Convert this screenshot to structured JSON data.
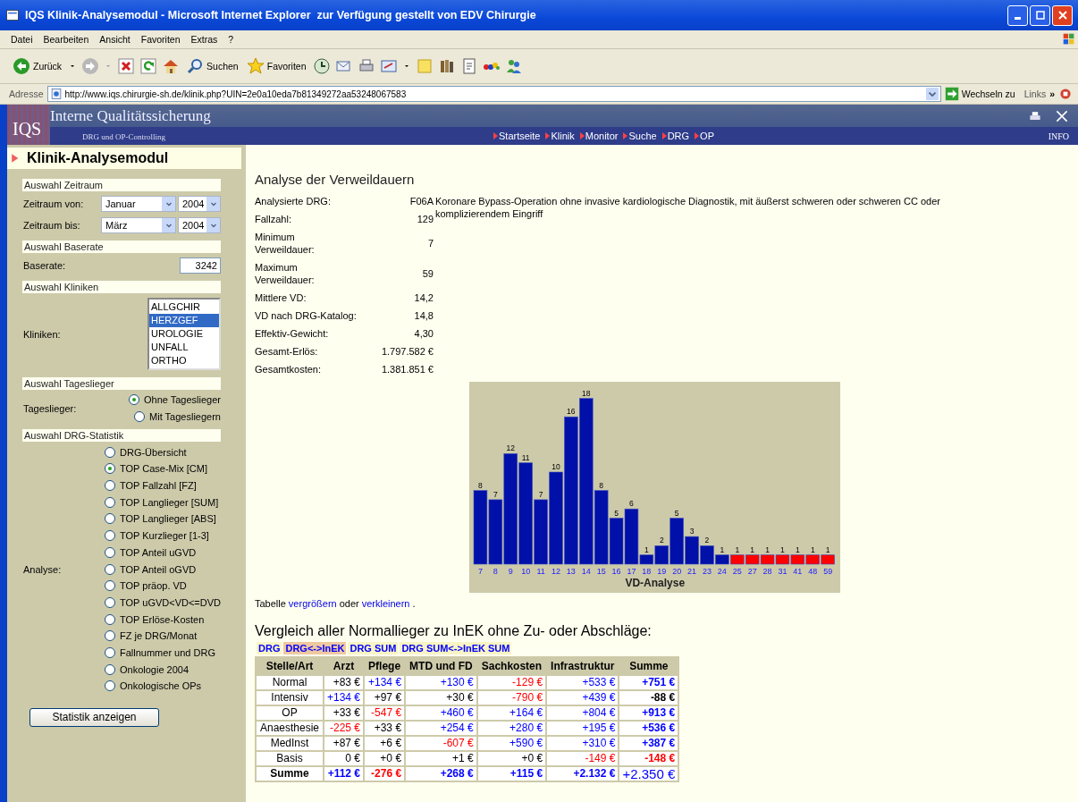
{
  "window": {
    "title": "IQS Klinik-Analysemodul - Microsoft Internet Explorer  zur Verfügung gestellt von EDV Chirurgie"
  },
  "menu": [
    "Datei",
    "Bearbeiten",
    "Ansicht",
    "Favoriten",
    "Extras",
    "?"
  ],
  "toolbar": {
    "back": "Zurück",
    "search": "Suchen",
    "favorites": "Favoriten"
  },
  "address_bar": {
    "label": "Adresse",
    "url": "http://www.iqs.chirurgie-sh.de/klinik.php?UIN=2e0a10eda7b81349272aa53248067583",
    "go": "Wechseln zu",
    "links": "Links",
    "more": "»"
  },
  "site_header": {
    "logo": "IQS",
    "title": "Interne Qualitätssicherung",
    "subtitle": "DRG und OP-Controlling",
    "nav": [
      "Startseite",
      "Klinik",
      "Monitor",
      "Suche",
      "DRG",
      "OP"
    ],
    "info": "INFO"
  },
  "sidebar": {
    "title": "Klinik-Analysemodul",
    "zeitraum": {
      "heading": "Auswahl Zeitraum",
      "rows": [
        {
          "label": "Zeitraum von:",
          "month": "Januar",
          "year": "2004"
        },
        {
          "label": "Zeitraum bis:",
          "month": "März",
          "year": "2004"
        }
      ]
    },
    "baserate": {
      "heading": "Auswahl Baserate",
      "label": "Baserate:",
      "value": "3242"
    },
    "kliniken": {
      "heading": "Auswahl Kliniken",
      "label": "Kliniken:",
      "options": [
        {
          "text": "ALLGCHIR",
          "selected": false
        },
        {
          "text": "HERZGEF",
          "selected": true
        },
        {
          "text": "UROLOGIE",
          "selected": false
        },
        {
          "text": "UNFALL",
          "selected": false
        },
        {
          "text": "ORTHO",
          "selected": false
        }
      ]
    },
    "tageslieger": {
      "heading": "Auswahl Tageslieger",
      "label": "Tageslieger:",
      "options": [
        {
          "text": "Ohne Tageslieger",
          "selected": true
        },
        {
          "text": "Mit Tagesliegern",
          "selected": false
        }
      ]
    },
    "statistik": {
      "heading": "Auswahl DRG-Statistik",
      "label": "Analyse:",
      "options": [
        {
          "text": "DRG-Übersicht",
          "selected": false
        },
        {
          "text": "TOP Case-Mix [CM]",
          "selected": true
        },
        {
          "text": "TOP Fallzahl [FZ]",
          "selected": false
        },
        {
          "text": "TOP Langlieger [SUM]",
          "selected": false
        },
        {
          "text": "TOP Langlieger [ABS]",
          "selected": false
        },
        {
          "text": "TOP Kurzlieger [1-3]",
          "selected": false
        },
        {
          "text": "TOP Anteil uGVD",
          "selected": false
        },
        {
          "text": "TOP Anteil oGVD",
          "selected": false
        },
        {
          "text": "TOP präop. VD",
          "selected": false
        },
        {
          "text": "TOP uGVD<VD<=DVD",
          "selected": false
        },
        {
          "text": "TOP Erlöse-Kosten",
          "selected": false
        },
        {
          "text": "FZ je DRG/Monat",
          "selected": false
        },
        {
          "text": "Fallnummer und DRG",
          "selected": false
        },
        {
          "text": "Onkologie 2004",
          "selected": false
        },
        {
          "text": "Onkologische OPs",
          "selected": false
        }
      ]
    },
    "submit": "Statistik anzeigen"
  },
  "analysis": {
    "title": "Analyse der Verweildauern",
    "drg_description": "Koronare Bypass-Operation ohne invasive kardiologische Diagnostik, mit äußerst schweren oder schweren CC oder komplizierendem Eingriff",
    "facts": [
      {
        "label": "Analysierte DRG:",
        "value": "F06A"
      },
      {
        "label": "Fallzahl:",
        "value": "129"
      },
      {
        "label": "Minimum\nVerweildauer:",
        "value": "7"
      },
      {
        "label": "Maximum\nVerweildauer:",
        "value": "59"
      },
      {
        "label": "Mittlere VD:",
        "value": "14,2"
      },
      {
        "label": "VD nach DRG-Katalog:",
        "value": "14,8"
      },
      {
        "label": "Effektiv-Gewicht:",
        "value": "4,30"
      },
      {
        "label": "Gesamt-Erlös:",
        "value": "1.797.582 €"
      },
      {
        "label": "Gesamtkosten:",
        "value": "1.381.851 €"
      }
    ],
    "chart_data": {
      "type": "bar",
      "xlabel": "VD-Analyse",
      "categories": [
        "7",
        "8",
        "9",
        "10",
        "11",
        "12",
        "13",
        "14",
        "15",
        "16",
        "17",
        "18",
        "19",
        "20",
        "21",
        "23",
        "24",
        "25",
        "27",
        "28",
        "31",
        "41",
        "48",
        "59"
      ],
      "data_labels": true,
      "series": [
        {
          "color": "#0010a8",
          "values": [
            8,
            7,
            12,
            11,
            7,
            10,
            16,
            18,
            8,
            5,
            6,
            1,
            2,
            5,
            3,
            2,
            1,
            null,
            null,
            null,
            null,
            null,
            null,
            null
          ]
        },
        {
          "color": "#ff0000",
          "values": [
            null,
            null,
            null,
            null,
            null,
            null,
            null,
            null,
            null,
            null,
            null,
            null,
            null,
            null,
            null,
            null,
            null,
            1,
            1,
            1,
            1,
            1,
            1,
            1
          ]
        }
      ]
    },
    "table_hint": {
      "before": "Tabelle",
      "link_enlarge": "vergrößern",
      "middle": "oder",
      "link_shrink": "verkleinern",
      "after": "."
    }
  },
  "comparison": {
    "title": "Vergleich aller Normallieger zu InEK ohne Zu- oder Abschläge:",
    "tabs": [
      {
        "label": "DRG",
        "selected": false
      },
      {
        "label": "DRG<->InEK",
        "selected": true
      },
      {
        "label": "DRG SUM",
        "selected": false
      },
      {
        "label": "DRG SUM<->InEK SUM",
        "selected": false
      }
    ],
    "columns": [
      "Stelle/Art",
      "Arzt",
      "Pflege",
      "MTD und FD",
      "Sachkosten",
      "Infrastruktur",
      "Summe"
    ],
    "rows": [
      {
        "cells": [
          {
            "text": "Normal",
            "color": "#000000"
          },
          {
            "text": "+83 €",
            "color": "#000000"
          },
          {
            "text": "+134 €",
            "color": "#0000ff"
          },
          {
            "text": "+130 €",
            "color": "#0000ff"
          },
          {
            "text": "-129 €",
            "color": "#ff0000"
          },
          {
            "text": "+533 €",
            "color": "#0000ff"
          },
          {
            "text": "+751 €",
            "color": "#0000ff"
          }
        ]
      },
      {
        "cells": [
          {
            "text": "Intensiv",
            "color": "#000000"
          },
          {
            "text": "+134 €",
            "color": "#0000ff"
          },
          {
            "text": "+97 €",
            "color": "#000000"
          },
          {
            "text": "+30 €",
            "color": "#000000"
          },
          {
            "text": "-790 €",
            "color": "#ff0000"
          },
          {
            "text": "+439 €",
            "color": "#0000ff"
          },
          {
            "text": "-88 €",
            "color": "#000000"
          }
        ]
      },
      {
        "cells": [
          {
            "text": "OP",
            "color": "#000000"
          },
          {
            "text": "+33 €",
            "color": "#000000"
          },
          {
            "text": "-547 €",
            "color": "#ff0000"
          },
          {
            "text": "+460 €",
            "color": "#0000ff"
          },
          {
            "text": "+164 €",
            "color": "#0000ff"
          },
          {
            "text": "+804 €",
            "color": "#0000ff"
          },
          {
            "text": "+913 €",
            "color": "#0000ff"
          }
        ]
      },
      {
        "cells": [
          {
            "text": "Anaesthesie",
            "color": "#000000"
          },
          {
            "text": "-225 €",
            "color": "#ff0000"
          },
          {
            "text": "+33 €",
            "color": "#000000"
          },
          {
            "text": "+254 €",
            "color": "#0000ff"
          },
          {
            "text": "+280 €",
            "color": "#0000ff"
          },
          {
            "text": "+195 €",
            "color": "#0000ff"
          },
          {
            "text": "+536 €",
            "color": "#0000ff"
          }
        ]
      },
      {
        "cells": [
          {
            "text": "MedInst",
            "color": "#000000"
          },
          {
            "text": "+87 €",
            "color": "#000000"
          },
          {
            "text": "+6 €",
            "color": "#000000"
          },
          {
            "text": "-607 €",
            "color": "#ff0000"
          },
          {
            "text": "+590 €",
            "color": "#0000ff"
          },
          {
            "text": "+310 €",
            "color": "#0000ff"
          },
          {
            "text": "+387 €",
            "color": "#0000ff"
          }
        ]
      },
      {
        "cells": [
          {
            "text": "Basis",
            "color": "#000000"
          },
          {
            "text": "0 €",
            "color": "#000000"
          },
          {
            "text": "+0 €",
            "color": "#000000"
          },
          {
            "text": "+1 €",
            "color": "#000000"
          },
          {
            "text": "+0 €",
            "color": "#000000"
          },
          {
            "text": "-149 €",
            "color": "#ff0000"
          },
          {
            "text": "-148 €",
            "color": "#ff0000"
          }
        ]
      },
      {
        "cells": [
          {
            "text": "Summe",
            "color": "#000000"
          },
          {
            "text": "+112 €",
            "color": "#0000ff"
          },
          {
            "text": "-276 €",
            "color": "#ff0000"
          },
          {
            "text": "+268 €",
            "color": "#0000ff"
          },
          {
            "text": "+115 €",
            "color": "#0000ff"
          },
          {
            "text": "+2.132 €",
            "color": "#0000ff"
          },
          {
            "text": "+2.350 €",
            "color": "#0000ff"
          }
        ]
      }
    ]
  }
}
